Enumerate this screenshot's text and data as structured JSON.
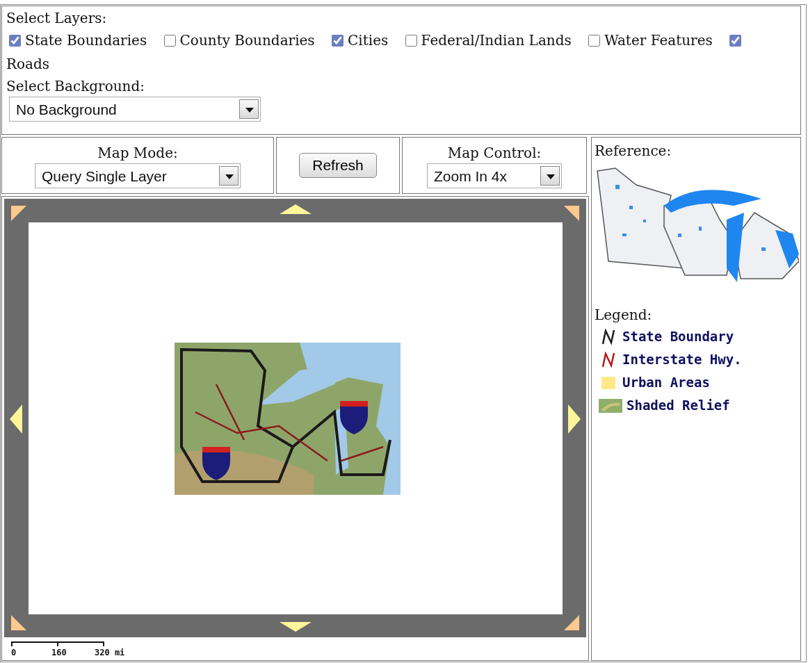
{
  "layers": {
    "label": "Select Layers:",
    "items": [
      {
        "label": "State Boundaries",
        "checked": true
      },
      {
        "label": "County Boundaries",
        "checked": false
      },
      {
        "label": "Cities",
        "checked": true
      },
      {
        "label": "Federal/Indian Lands",
        "checked": false
      },
      {
        "label": "Water Features",
        "checked": false
      },
      {
        "label": "Roads",
        "checked": true
      }
    ]
  },
  "background": {
    "label": "Select Background:",
    "value": "No Background"
  },
  "map_mode": {
    "label": "Map Mode:",
    "value": "Query Single Layer"
  },
  "refresh_button": "Refresh",
  "map_control": {
    "label": "Map Control:",
    "value": "Zoom In 4x"
  },
  "scale_bar": {
    "labels": [
      "0",
      "160",
      "320 mi"
    ]
  },
  "reference": {
    "label": "Reference:",
    "kind": "picture"
  },
  "legend": {
    "label": "Legend:",
    "items": [
      {
        "kind": "line",
        "color": "#1a1a1a",
        "label": "State Boundary"
      },
      {
        "kind": "line",
        "color": "#b01c1c",
        "label": "Interstate Hwy."
      },
      {
        "kind": "fill",
        "color": "#fde98a",
        "label": "Urban Areas"
      },
      {
        "kind": "relief",
        "color": "#8fae6a",
        "label": "Shaded Relief"
      }
    ]
  }
}
